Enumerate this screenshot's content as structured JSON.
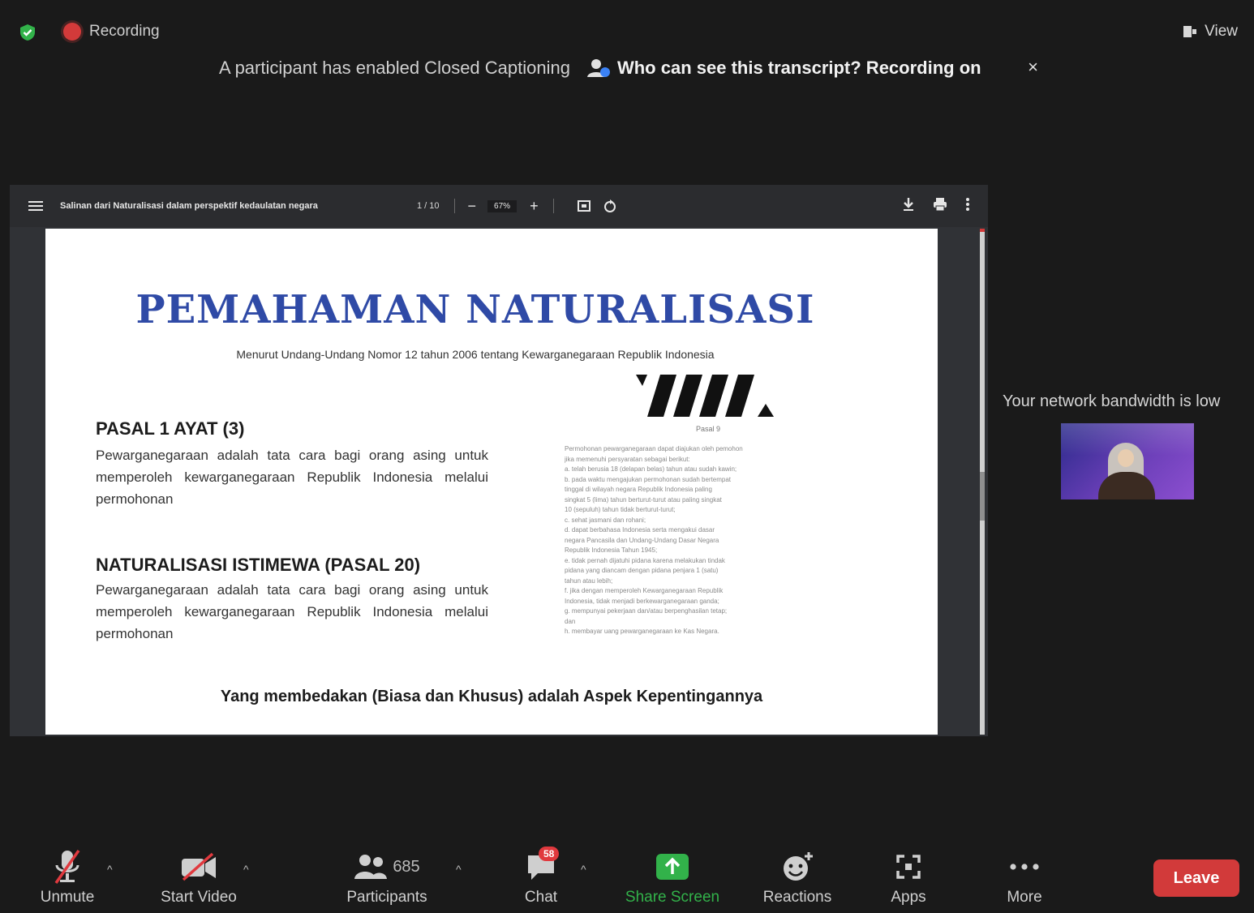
{
  "top_bar": {
    "recording_label": "Recording",
    "view_label": "View",
    "notice_message": "A participant has enabled Closed Captioning",
    "notice_link": "Who can see this transcript? Recording on",
    "close_glyph": "×"
  },
  "pdf_viewer": {
    "filename": "Salinan dari Naturalisasi dalam perspektif kedaulatan negara",
    "page_indicator": "1 / 10",
    "zoom": "67%",
    "minus": "−",
    "plus": "+"
  },
  "slide": {
    "title": "PEMAHAMAN NATURALISASI",
    "subtitle": "Menurut Undang-Undang Nomor 12 tahun 2006 tentang Kewarganegaraan Republik Indonesia",
    "logo_caption": "Pasal 9",
    "section1_heading": "PASAL 1 AYAT (3)",
    "section1_body": "Pewarganegaraan adalah tata cara bagi orang asing untuk memperoleh kewarganegaraan Republik Indonesia melalui permohonan",
    "section2_heading": "NATURALISASI ISTIMEWA (PASAL 20)",
    "section2_body": "Pewarganegaraan adalah tata cara bagi orang asing untuk memperoleh kewarganegaraan Republik Indonesia melalui permohonan",
    "article_lines": [
      "Permohonan pewarganegaraan dapat diajukan oleh pemohon",
      "jika memenuhi persyaratan sebagai berikut:",
      "a.   telah berusia 18 (delapan belas) tahun atau sudah kawin;",
      "b.   pada waktu mengajukan permohonan sudah bertempat",
      "      tinggal di wilayah negara Republik Indonesia paling",
      "      singkat 5 (lima) tahun berturut-turut atau paling singkat",
      "      10 (sepuluh) tahun tidak berturut-turut;",
      "c.   sehat jasmani dan rohani;",
      "d.   dapat berbahasa Indonesia serta mengakui dasar",
      "      negara Pancasila dan Undang-Undang Dasar Negara",
      "      Republik Indonesia Tahun 1945;",
      "e.   tidak pernah dijatuhi pidana karena melakukan tindak",
      "      pidana yang diancam dengan pidana penjara 1 (satu)",
      "      tahun atau lebih;",
      "f.   jika dengan memperoleh Kewarganegaraan Republik",
      "      Indonesia, tidak menjadi berkewarganegaraan ganda;",
      "g.   mempunyai pekerjaan dan/atau berpenghasilan tetap;",
      "      dan",
      "h.   membayar uang pewarganegaraan ke Kas Negara."
    ],
    "bottom_line": "Yang membedakan (Biasa dan Khusus) adalah Aspek Kepentingannya"
  },
  "side": {
    "bandwidth_message": "Your network bandwidth is low"
  },
  "footer": {
    "unmute": "Unmute",
    "start_video": "Start Video",
    "participants": "Participants",
    "participants_count": "685",
    "chat": "Chat",
    "chat_badge": "58",
    "share_screen": "Share Screen",
    "reactions": "Reactions",
    "apps": "Apps",
    "more": "More",
    "leave": "Leave",
    "caret": "^"
  },
  "colors": {
    "background": "#1a1a1a",
    "title_blue": "#2f4aa6",
    "leave_red": "#d23a3a",
    "share_green": "#32b24a"
  }
}
